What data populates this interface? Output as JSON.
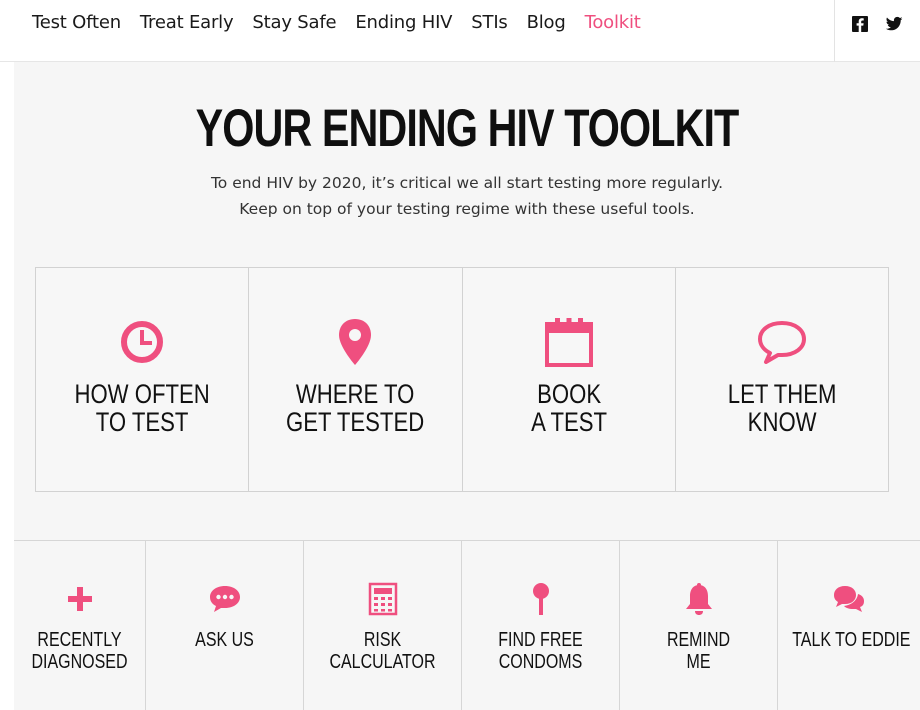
{
  "nav": {
    "links": [
      {
        "label": "Test Often",
        "active": false
      },
      {
        "label": "Treat Early",
        "active": false
      },
      {
        "label": "Stay Safe",
        "active": false
      },
      {
        "label": "Ending HIV",
        "active": false
      },
      {
        "label": "STIs",
        "active": false
      },
      {
        "label": "Blog",
        "active": false
      },
      {
        "label": "Toolkit",
        "active": true
      }
    ],
    "social_icons": [
      "facebook-icon",
      "twitter-icon"
    ]
  },
  "hero": {
    "title": "YOUR ENDING HIV TOOLKIT",
    "subtitle_line1": "To end HIV by 2020, it’s critical we all start testing more regularly.",
    "subtitle_line2": "Keep on top of your testing regime with these useful tools."
  },
  "big_tools": [
    {
      "icon": "clock-icon",
      "line1": "HOW OFTEN",
      "line2": "TO TEST"
    },
    {
      "icon": "map-pin-icon",
      "line1": "WHERE TO",
      "line2": "GET TESTED"
    },
    {
      "icon": "calendar-icon",
      "line1": "BOOK",
      "line2": "A TEST"
    },
    {
      "icon": "speech-bubble-icon",
      "line1": "LET THEM",
      "line2": "KNOW"
    }
  ],
  "small_tools": [
    {
      "icon": "plus-icon",
      "line1": "RECENTLY",
      "line2": "DIAGNOSED"
    },
    {
      "icon": "chat-dots-icon",
      "line1": "ASK US",
      "line2": ""
    },
    {
      "icon": "calculator-icon",
      "line1": "RISK",
      "line2": "CALCULATOR"
    },
    {
      "icon": "condom-icon",
      "line1": "FIND FREE",
      "line2": "CONDOMS"
    },
    {
      "icon": "bell-icon",
      "line1": "REMIND",
      "line2": "ME"
    },
    {
      "icon": "chat-bubbles-icon",
      "line1": "TALK TO EDDIE",
      "line2": ""
    }
  ],
  "colors": {
    "accent": "#ef4f7f",
    "text": "#111111",
    "panel_bg": "#f6f6f6",
    "border": "#d2d2d2"
  }
}
